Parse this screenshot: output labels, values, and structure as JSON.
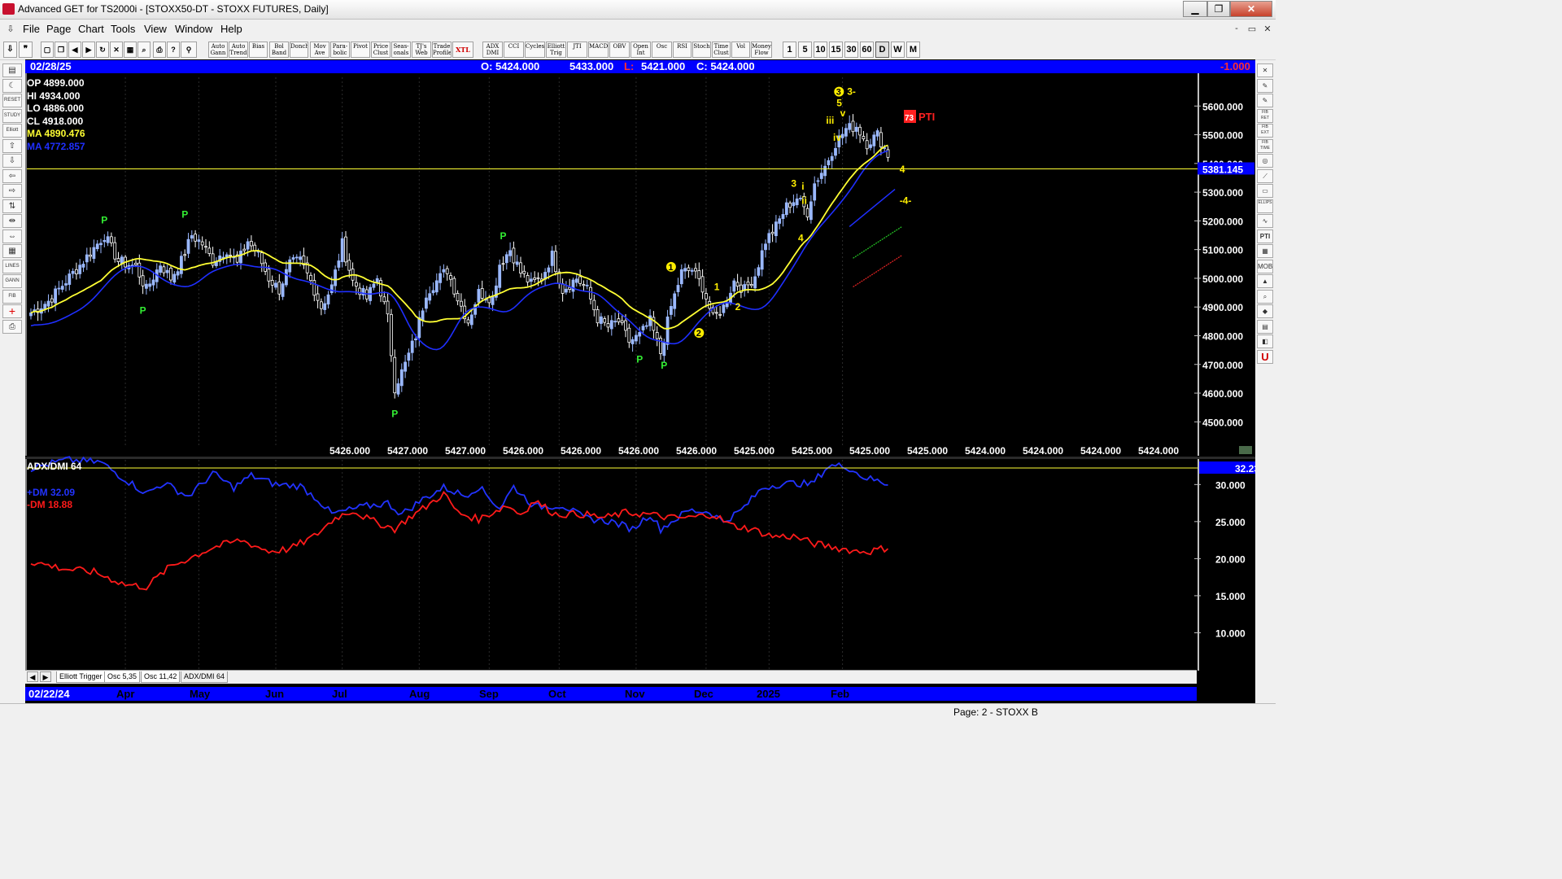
{
  "window": {
    "title": "Advanced GET for TS2000i - [STOXX50-DT - STOXX FUTURES, Daily]",
    "min": "▁",
    "max": "❐",
    "close": "✕"
  },
  "menu": [
    "File",
    "Page",
    "Chart",
    "Tools",
    "View",
    "Window",
    "Help"
  ],
  "mdi_controls": [
    "-",
    "▭",
    "✕"
  ],
  "toolbar": {
    "study_buttons": [
      "Auto Gann",
      "Auto Trend",
      "Bias",
      "Bol Band",
      "Donch",
      "Mov Ave",
      "Para- bolic",
      "Pivot",
      "Price Clust",
      "Seas- onals",
      "TJ's Web",
      "Trade Profile",
      "XTL",
      "ADX DMI",
      "CCI",
      "Cycles",
      "Elliott Trig",
      "JTI",
      "MACD",
      "OBV",
      "Open Int",
      "Osc",
      "RSI",
      "Stoch",
      "Time Clust",
      "Vol",
      "Money Flow"
    ],
    "timeframes": [
      "1",
      "5",
      "10",
      "15",
      "30",
      "60",
      "D",
      "W",
      "M"
    ],
    "active_timeframe": "D"
  },
  "left_tools": [
    "file-open-icon",
    "moon-icon",
    "reset-icon",
    "study-icon",
    "elliott-icon",
    "up-arrow-icon",
    "down-arrow-icon",
    "left-arrow-icon",
    "right-arrow-icon",
    "fib-icon",
    "expand-icon",
    "contract-icon",
    "grid-icon",
    "lines-icon",
    "gann-icon",
    "fib-lines-icon",
    "crosshair-icon",
    "print-icon"
  ],
  "left_tool_labels": [
    "",
    "",
    "RESET",
    "STUDY",
    "Elliott",
    "",
    "",
    "",
    "",
    "",
    "",
    "",
    "",
    "LINES",
    "GANN",
    "FIB",
    "+",
    ""
  ],
  "right_tools": [
    "close-icon",
    "pencil-icon",
    "pencil2-icon",
    "fib-ret-icon",
    "fib-ext-icon",
    "fib-time-icon",
    "search-icon",
    "fan-icon",
    "box-icon",
    "ellipse-icon",
    "wave-icon",
    "pti-icon",
    "grid-icon",
    "mob-icon",
    "triangle-icon",
    "zoom-icon",
    "tag-icon",
    "calendar-icon",
    "layer-icon",
    "magnet-icon"
  ],
  "right_tool_labels": [
    "✕",
    "✎",
    "✎",
    "FIB RET",
    "FIB EXT",
    "FIB TIME",
    "◎",
    "⟋",
    "▭",
    "ELLIPS",
    "∿",
    "PTI",
    "▦",
    "MOB",
    "▲",
    "⌕",
    "◆",
    "▤",
    "◧",
    "U"
  ],
  "header": {
    "date": "02/28/25",
    "open": "O: 5424.000",
    "high": "5433.000",
    "low_label": "L:",
    "low": "5421.000",
    "close": "C: 5424.000",
    "change": "-1.000"
  },
  "legend": {
    "op": "OP  4899.000",
    "hi": "HI   4934.000",
    "lo": "LO   4886.000",
    "cl": "CL   4918.000",
    "ma1": "MA  4890.476",
    "ma2": "MA  4772.857"
  },
  "colors": {
    "up_candle": "#9ab8ff",
    "down_candle": "#ffffff",
    "ma_fast": "#ffff33",
    "ma_slow": "#1f2fff",
    "pivot": "#33ee33",
    "wave": "#ffee00",
    "plus_dm": "#2233ff",
    "minus_dm": "#ff1a1a",
    "header_bg": "#0000ff",
    "pti": "#ff2020"
  },
  "chart_data": [
    {
      "type": "candlestick",
      "title": "STOXX50-DT - STOXX FUTURES, Daily",
      "ylim": [
        4430,
        5700
      ],
      "y_ticks": [
        "5600.000",
        "5500.000",
        "5400.000",
        "5300.000",
        "5200.000",
        "5100.000",
        "5000.000",
        "4900.000",
        "4800.000",
        "4700.000",
        "4600.000",
        "4500.000"
      ],
      "y_tick_values": [
        5600,
        5500,
        5400,
        5300,
        5200,
        5100,
        5000,
        4900,
        4800,
        4700,
        4600,
        4500
      ],
      "current_price_line": 5381.145,
      "current_price_label": "5381.145",
      "bottom_values": [
        "5426.000",
        "5427.000",
        "5427.000",
        "5426.000",
        "5426.000",
        "5426.000",
        "5426.000",
        "5425.000",
        "5425.000",
        "5425.000",
        "5425.000",
        "5424.000",
        "5424.000",
        "5424.000",
        "5424.000"
      ],
      "x_labels": [
        "02/22/24",
        "Apr",
        "May",
        "Jun",
        "Jul",
        "Aug",
        "Sep",
        "Oct",
        "Nov",
        "Dec",
        "2025",
        "Feb"
      ],
      "close_anchors": [
        [
          0,
          4880
        ],
        [
          5,
          4920
        ],
        [
          10,
          4990
        ],
        [
          15,
          5060
        ],
        [
          21,
          5150
        ],
        [
          25,
          5060
        ],
        [
          30,
          5040
        ],
        [
          33,
          4960
        ],
        [
          37,
          5050
        ],
        [
          40,
          5000
        ],
        [
          43,
          5060
        ],
        [
          46,
          5150
        ],
        [
          49,
          5120
        ],
        [
          52,
          5060
        ],
        [
          56,
          5100
        ],
        [
          59,
          5050
        ],
        [
          62,
          5130
        ],
        [
          65,
          5080
        ],
        [
          68,
          5000
        ],
        [
          71,
          4960
        ],
        [
          74,
          5050
        ],
        [
          77,
          5060
        ],
        [
          80,
          4990
        ],
        [
          83,
          4900
        ],
        [
          86,
          4970
        ],
        [
          89,
          5120
        ],
        [
          92,
          4990
        ],
        [
          96,
          4930
        ],
        [
          99,
          5000
        ],
        [
          102,
          4860
        ],
        [
          104,
          4620
        ],
        [
          107,
          4700
        ],
        [
          110,
          4800
        ],
        [
          113,
          4950
        ],
        [
          116,
          4990
        ],
        [
          119,
          5030
        ],
        [
          122,
          4930
        ],
        [
          125,
          4850
        ],
        [
          128,
          4950
        ],
        [
          132,
          4930
        ],
        [
          134,
          5050
        ],
        [
          137,
          5100
        ],
        [
          140,
          5020
        ],
        [
          143,
          4980
        ],
        [
          146,
          5000
        ],
        [
          149,
          5080
        ],
        [
          152,
          4960
        ],
        [
          156,
          5000
        ],
        [
          159,
          4960
        ],
        [
          162,
          4860
        ],
        [
          165,
          4830
        ],
        [
          168,
          4850
        ],
        [
          171,
          4780
        ],
        [
          174,
          4800
        ],
        [
          177,
          4850
        ],
        [
          180,
          4740
        ],
        [
          183,
          4900
        ],
        [
          186,
          5020
        ],
        [
          189,
          5030
        ],
        [
          192,
          4970
        ],
        [
          195,
          4860
        ],
        [
          198,
          4900
        ],
        [
          201,
          4990
        ],
        [
          204,
          4960
        ],
        [
          207,
          5010
        ],
        [
          210,
          5130
        ],
        [
          213,
          5180
        ],
        [
          216,
          5250
        ],
        [
          219,
          5280
        ],
        [
          222,
          5230
        ],
        [
          224,
          5330
        ],
        [
          227,
          5390
        ],
        [
          230,
          5470
        ],
        [
          233,
          5520
        ],
        [
          236,
          5530
        ],
        [
          239,
          5470
        ],
        [
          242,
          5500
        ],
        [
          245,
          5430
        ]
      ],
      "pivot_labels": [
        {
          "text": "P",
          "bar": 21,
          "price": 5205
        },
        {
          "text": "P",
          "bar": 32,
          "price": 4890
        },
        {
          "text": "P",
          "bar": 44,
          "price": 5225
        },
        {
          "text": "P",
          "bar": 104,
          "price": 4530
        },
        {
          "text": "P",
          "bar": 135,
          "price": 5150
        },
        {
          "text": "P",
          "bar": 174,
          "price": 4720
        },
        {
          "text": "P",
          "bar": 181,
          "price": 4700
        }
      ],
      "wave_labels": [
        {
          "text": "1",
          "bar": 183,
          "price": 5040,
          "circled": true
        },
        {
          "text": "2",
          "bar": 191,
          "price": 4810,
          "circled": true
        },
        {
          "text": "1",
          "bar": 196,
          "price": 4970,
          "circled": false
        },
        {
          "text": "2",
          "bar": 202,
          "price": 4900,
          "circled": false
        },
        {
          "text": "3",
          "bar": 218,
          "price": 5330,
          "circled": false
        },
        {
          "text": "i",
          "bar": 221,
          "price": 5320,
          "circled": false
        },
        {
          "text": "ii",
          "bar": 221,
          "price": 5270,
          "circled": false
        },
        {
          "text": "4",
          "bar": 220,
          "price": 5140,
          "circled": false
        },
        {
          "text": "iii",
          "bar": 228,
          "price": 5550,
          "circled": false
        },
        {
          "text": "iv",
          "bar": 230,
          "price": 5490,
          "circled": false
        },
        {
          "text": "v",
          "bar": 232,
          "price": 5575,
          "circled": false
        },
        {
          "text": "5",
          "bar": 231,
          "price": 5610,
          "circled": false
        },
        {
          "text": "3",
          "bar": 231,
          "price": 5650,
          "circled": true
        },
        {
          "text": "3-",
          "bar": 234,
          "price": 5650,
          "circled": false
        },
        {
          "text": "4",
          "bar": 249,
          "price": 5380,
          "circled": false
        },
        {
          "text": "-4-",
          "bar": 249,
          "price": 5270,
          "circled": false
        }
      ],
      "pti_value": "73",
      "pti_label": "PTI"
    },
    {
      "type": "line",
      "title": "ADX/DMI 64",
      "ylim": [
        5,
        33
      ],
      "y_ticks": [
        "30.000",
        "25.000",
        "20.000",
        "15.000",
        "10.000"
      ],
      "y_tick_values": [
        30,
        25,
        20,
        15,
        10
      ],
      "adx_value_label": "32.23",
      "adx_value": 32.23,
      "series": [
        {
          "name": "+DM 32.09",
          "color": "#2233ff",
          "anchors": [
            [
              0,
              32.2
            ],
            [
              10,
              33.3
            ],
            [
              20,
              33
            ],
            [
              26,
              31
            ],
            [
              33,
              28.8
            ],
            [
              38,
              30.2
            ],
            [
              45,
              28.4
            ],
            [
              52,
              31.5
            ],
            [
              58,
              29.6
            ],
            [
              63,
              31.2
            ],
            [
              70,
              30
            ],
            [
              77,
              29.8
            ],
            [
              82,
              28
            ],
            [
              86,
              26
            ],
            [
              95,
              27
            ],
            [
              102,
              27.5
            ],
            [
              106,
              26
            ],
            [
              112,
              28
            ],
            [
              118,
              29.6
            ],
            [
              124,
              28.5
            ],
            [
              128,
              29.7
            ],
            [
              134,
              26.8
            ],
            [
              138,
              29.7
            ],
            [
              144,
              27
            ],
            [
              152,
              27.2
            ],
            [
              158,
              25.5
            ],
            [
              166,
              25
            ],
            [
              172,
              24
            ],
            [
              177,
              26
            ],
            [
              180,
              24
            ],
            [
              188,
              26.5
            ],
            [
              194,
              26.3
            ],
            [
              198,
              25
            ],
            [
              203,
              26.5
            ],
            [
              209,
              29.5
            ],
            [
              213,
              30
            ],
            [
              219,
              30.2
            ],
            [
              223,
              30
            ],
            [
              228,
              32.5
            ],
            [
              233,
              32.5
            ],
            [
              238,
              31
            ],
            [
              245,
              30.1
            ]
          ]
        },
        {
          "name": "-DM  18.88",
          "color": "#ff1a1a",
          "anchors": [
            [
              0,
              19.6
            ],
            [
              10,
              18.6
            ],
            [
              18,
              18.2
            ],
            [
              27,
              16.5
            ],
            [
              33,
              16.2
            ],
            [
              40,
              19
            ],
            [
              45,
              20
            ],
            [
              52,
              21.5
            ],
            [
              60,
              22.5
            ],
            [
              68,
              21
            ],
            [
              74,
              21.3
            ],
            [
              81,
              23
            ],
            [
              87,
              25.5
            ],
            [
              92,
              26.5
            ],
            [
              97,
              25.2
            ],
            [
              104,
              24
            ],
            [
              108,
              25.5
            ],
            [
              113,
              27
            ],
            [
              118,
              28.8
            ],
            [
              122,
              26.2
            ],
            [
              128,
              25.3
            ],
            [
              136,
              27.2
            ],
            [
              140,
              26
            ],
            [
              144,
              27.8
            ],
            [
              150,
              26
            ],
            [
              158,
              26
            ],
            [
              164,
              25.5
            ],
            [
              170,
              26.2
            ],
            [
              176,
              26
            ],
            [
              183,
              25.5
            ],
            [
              188,
              25.5
            ],
            [
              195,
              26
            ],
            [
              200,
              24.5
            ],
            [
              206,
              24
            ],
            [
              212,
              23
            ],
            [
              218,
              23
            ],
            [
              224,
              22
            ],
            [
              230,
              21.5
            ],
            [
              236,
              21
            ],
            [
              240,
              21
            ],
            [
              245,
              21.5
            ]
          ]
        },
        {
          "name": "ADX",
          "color": "#ffff33",
          "anchors": [
            [
              0,
              32.23
            ],
            [
              245,
              32.23
            ]
          ]
        }
      ]
    }
  ],
  "indicator_title": "ADX/DMI 64",
  "tabs": [
    "Elliott Trigger",
    "Osc 5,35",
    "Osc 11,42",
    "ADX/DMI 64"
  ],
  "status": "Page: 2 - STOXX B"
}
